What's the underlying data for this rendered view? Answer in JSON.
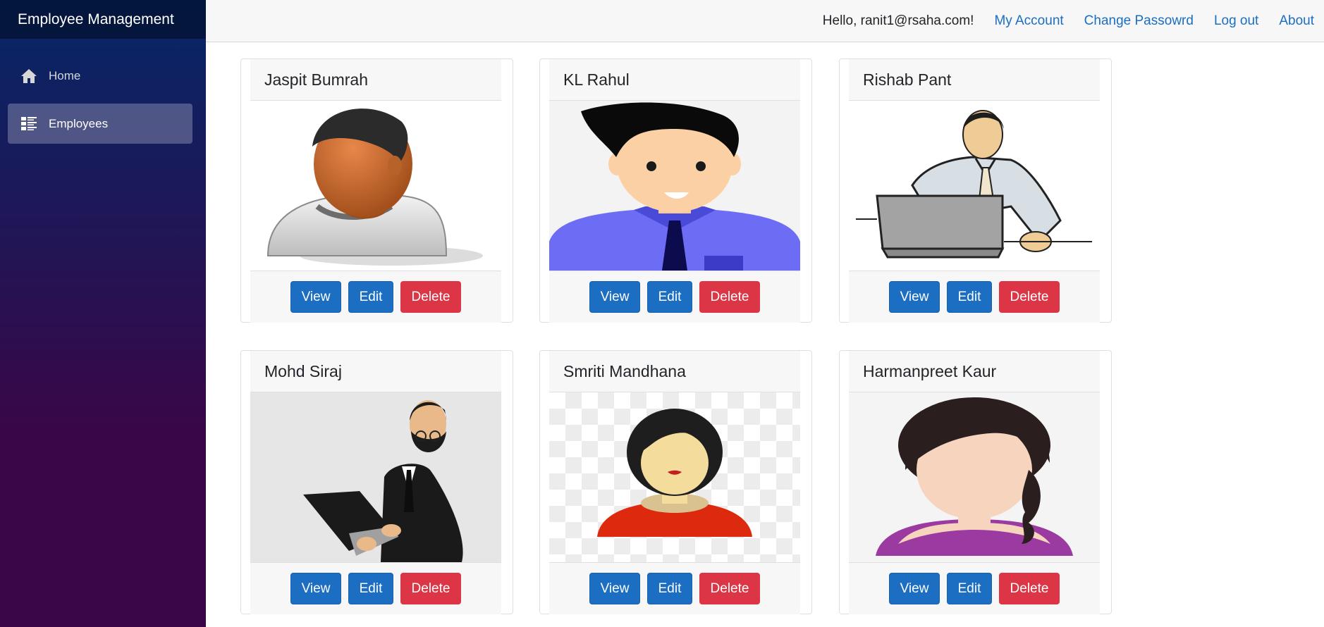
{
  "brand": "Employee Management",
  "nav": [
    {
      "label": "Home",
      "icon": "home-icon"
    },
    {
      "label": "Employees",
      "icon": "list-icon",
      "active": true
    }
  ],
  "topbar": {
    "greeting": "Hello, ranit1@rsaha.com!",
    "links": [
      "My Account",
      "Change Passowrd",
      "Log out",
      "About"
    ]
  },
  "buttons": {
    "view": "View",
    "edit": "Edit",
    "delete": "Delete"
  },
  "employees": [
    {
      "name": "Jaspit Bumrah",
      "avatar": "male-avatar-icon"
    },
    {
      "name": "KL Rahul",
      "avatar": "cartoon-man-icon"
    },
    {
      "name": "Rishab Pant",
      "avatar": "man-laptop-icon"
    },
    {
      "name": "Mohd Siraj",
      "avatar": "businessman-laptop-icon"
    },
    {
      "name": "Smriti Mandhana",
      "avatar": "female-avatar-icon"
    },
    {
      "name": "Harmanpreet Kaur",
      "avatar": "woman-avatar-icon"
    }
  ],
  "colors": {
    "primary": "#1b6ec2",
    "danger": "#dc3545",
    "sidebar_top": "#052767",
    "sidebar_bottom": "#3a0647"
  }
}
